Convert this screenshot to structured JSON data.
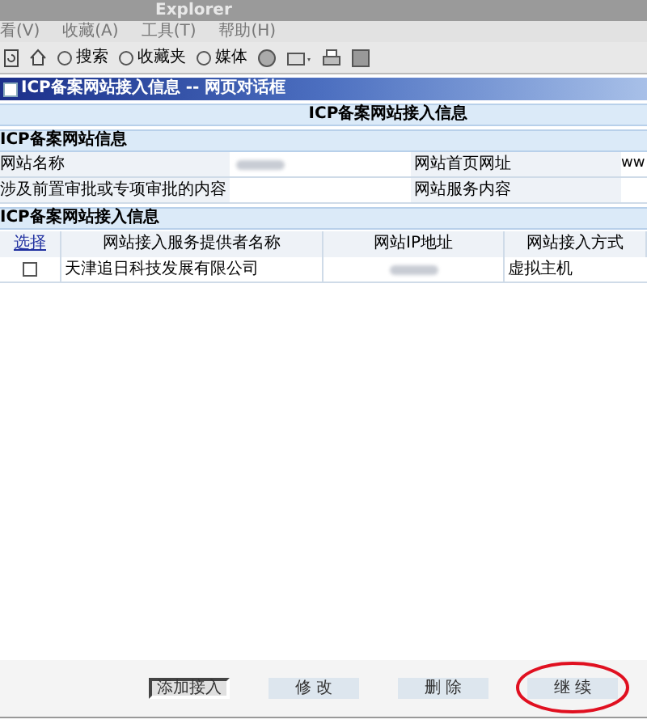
{
  "browser": {
    "title": "Explorer",
    "menu": [
      "看(V)",
      "收藏(A)",
      "工具(T)",
      "帮助(H)"
    ],
    "toolbar": [
      "搜索",
      "收藏夹",
      "媒体"
    ]
  },
  "dialog": {
    "title": "ICP备案网站接入信息 -- 网页对话框",
    "heading": "ICP备案网站接入信息",
    "site_section": {
      "title": "ICP备案网站信息",
      "rows": [
        {
          "label": "网站名称",
          "value_redacted": true,
          "label_2": "网站首页网址",
          "value_2": "ww"
        },
        {
          "label": "涉及前置审批或专项审批的内容",
          "value_redacted": false,
          "label_2": "网站服务内容",
          "value_2": ""
        }
      ]
    },
    "access_section": {
      "title": "ICP备案网站接入信息",
      "select_link": "选择",
      "columns": [
        "网站接入服务提供者名称",
        "网站IP地址",
        "网站接入方式"
      ],
      "rows": [
        {
          "checked": false,
          "provider": "天津追日科技发展有限公司",
          "ip_redacted": true,
          "method": "虚拟主机"
        }
      ]
    },
    "buttons": [
      {
        "label": "添加接入",
        "pressed": true,
        "circled": false
      },
      {
        "label": "修 改",
        "pressed": false,
        "circled": false
      },
      {
        "label": "删 除",
        "pressed": false,
        "circled": false
      },
      {
        "label": "继 续",
        "pressed": false,
        "circled": true
      }
    ]
  }
}
